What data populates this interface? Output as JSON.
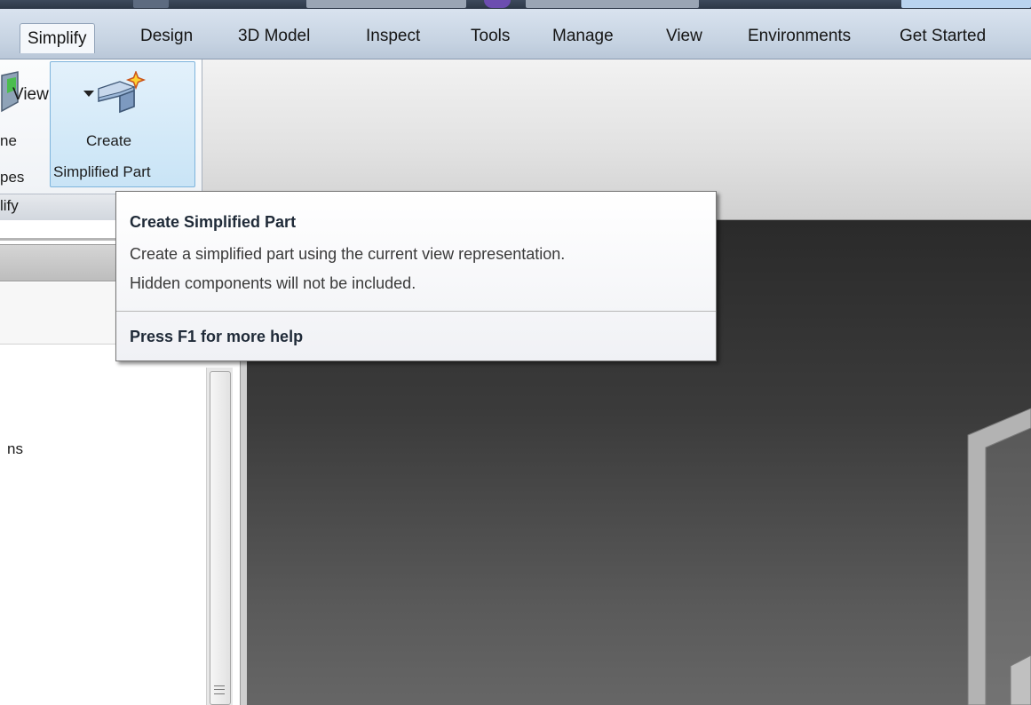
{
  "ribbon": {
    "tabs": [
      "Simplify",
      "Design",
      "3D Model",
      "Inspect",
      "Tools",
      "Manage",
      "View",
      "Environments",
      "Get Started"
    ],
    "active_tab": "Simplify",
    "buttons": {
      "prev_button_line1": "ne",
      "prev_button_line2": "pes",
      "create_line1": "Create",
      "create_line2": "Simplified Part"
    },
    "panel_title": "lify"
  },
  "browser": {
    "view_label": "View",
    "tree_item": "ns"
  },
  "tooltip": {
    "title": "Create Simplified Part",
    "line1": "Create a simplified part using the current view representation.",
    "line2": "Hidden components will not be included.",
    "help": "Press F1 for more help"
  },
  "icons": {
    "create_simplified_part": "part-with-star-icon",
    "previous": "shape-icon",
    "view_dropdown": "chevron-down-icon",
    "scroll_grip": "grip-icon"
  },
  "colors": {
    "ribbon_tab_bg": "#c5d2e1",
    "active_button_bg": "#c9e4f6",
    "viewport_top": "#2a2a2a",
    "viewport_bottom": "#666666"
  }
}
